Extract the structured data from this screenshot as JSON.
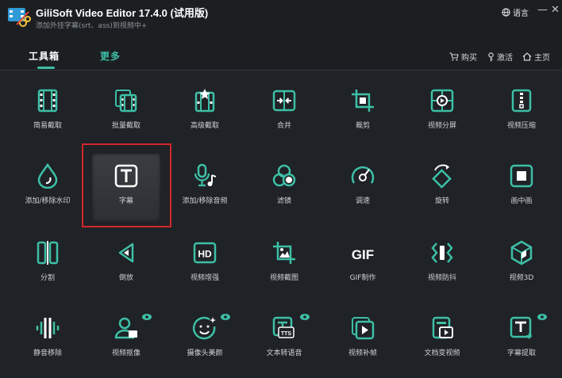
{
  "titlebar": {
    "title": "GiliSoft Video Editor 17.4.0 (试用版)",
    "subtitle": "添加外挂字幕(srt、ass)到视频中+",
    "language": "语言"
  },
  "nav": {
    "tabs": [
      {
        "label": "工具箱",
        "active": true
      },
      {
        "label": "更多",
        "active": false
      }
    ],
    "links": {
      "buy": "购买",
      "activate": "激活",
      "home": "主页"
    }
  },
  "colors": {
    "accent": "#3dbfa6",
    "highlight_border": "#d5262b",
    "background": "#1f2226"
  },
  "tools": [
    [
      {
        "label": "简易截取",
        "icon": "film-strip-icon"
      },
      {
        "label": "批量截取",
        "icon": "batch-film-icon"
      },
      {
        "label": "高级截取",
        "icon": "star-film-icon"
      },
      {
        "label": "合并",
        "icon": "merge-icon"
      },
      {
        "label": "裁剪",
        "icon": "crop-icon"
      },
      {
        "label": "视频分屏",
        "icon": "split-screen-icon"
      },
      {
        "label": "视频压缩",
        "icon": "compress-icon"
      }
    ],
    [
      {
        "label": "添加/移除水印",
        "icon": "droplet-icon"
      },
      {
        "label": "字幕",
        "icon": "subtitle-t-icon",
        "selected": true
      },
      {
        "label": "添加/移除音频",
        "icon": "mic-music-icon"
      },
      {
        "label": "滤镜",
        "icon": "filter-circles-icon"
      },
      {
        "label": "调速",
        "icon": "speedometer-icon"
      },
      {
        "label": "旋转",
        "icon": "rotate-icon"
      },
      {
        "label": "画中画",
        "icon": "picture-in-picture-icon"
      }
    ],
    [
      {
        "label": "分割",
        "icon": "split-bars-icon"
      },
      {
        "label": "倒放",
        "icon": "reverse-play-icon"
      },
      {
        "label": "视频增强",
        "icon": "hd-icon",
        "badge": "HD"
      },
      {
        "label": "视频截图",
        "icon": "screenshot-image-icon"
      },
      {
        "label": "GIF制作",
        "icon": "gif-icon",
        "badge": "GIF"
      },
      {
        "label": "视频防抖",
        "icon": "stabilize-icon"
      },
      {
        "label": "视频3D",
        "icon": "cube-3d-icon"
      }
    ],
    [
      {
        "label": "静音移除",
        "icon": "waveform-icon"
      },
      {
        "label": "视频抠像",
        "icon": "person-cutout-icon",
        "ai": true
      },
      {
        "label": "摄像头美颜",
        "icon": "face-beauty-icon",
        "ai": true
      },
      {
        "label": "文本转语音",
        "icon": "text-to-speech-icon",
        "ai": true,
        "badge": "TTS"
      },
      {
        "label": "视频补帧",
        "icon": "frame-interp-icon"
      },
      {
        "label": "文档变视频",
        "icon": "doc-to-video-icon"
      },
      {
        "label": "字幕提取",
        "icon": "subtitle-extract-icon",
        "ai": true
      }
    ]
  ]
}
